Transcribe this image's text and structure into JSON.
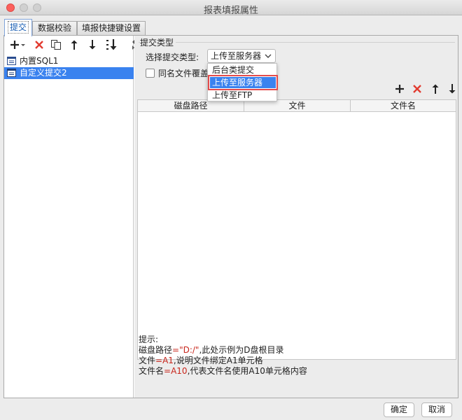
{
  "window": {
    "title": "报表填报属性"
  },
  "tabs": [
    {
      "label": "提交"
    },
    {
      "label": "数据校验"
    },
    {
      "label": "填报快捷键设置"
    }
  ],
  "left_toolbar": [
    "add-icon",
    "delete-icon",
    "copy-icon",
    "move-up-icon",
    "move-down-icon",
    "sort-icon"
  ],
  "list": {
    "items": [
      {
        "label": "内置SQL1",
        "icon": "sql-icon"
      },
      {
        "label": "自定义提交2",
        "icon": "custom-submit-icon"
      }
    ],
    "selected_index": 1
  },
  "submit": {
    "group_title": "提交类型",
    "type_label": "选择提交类型:",
    "selected": "上传至服务器",
    "options": [
      "后台类提交",
      "上传至服务器",
      "上传至FTP"
    ],
    "overwrite_label": "同名文件覆盖",
    "overwrite_checked": false
  },
  "right_toolbar": [
    "add-icon",
    "delete-icon",
    "move-up-icon",
    "move-down-icon"
  ],
  "table": {
    "columns": [
      "磁盘路径",
      "文件",
      "文件名"
    ]
  },
  "hint": {
    "title": "提示:",
    "line1": {
      "a": "磁盘路径",
      "b": "=\"D:/\"",
      "c": ",此处示例为D盘根目录"
    },
    "line2": {
      "a": "文件",
      "b": "=A1",
      "c": ",说明文件绑定A1单元格"
    },
    "line3": {
      "a": "文件名",
      "b": "=A10",
      "c": ",代表文件名使用A10单元格内容"
    }
  },
  "buttons": {
    "ok": "确定",
    "cancel": "取消"
  },
  "colors": {
    "accent": "#3a82ef",
    "delete_red": "#e23b30",
    "highlight_outline": "#e34b4b"
  }
}
